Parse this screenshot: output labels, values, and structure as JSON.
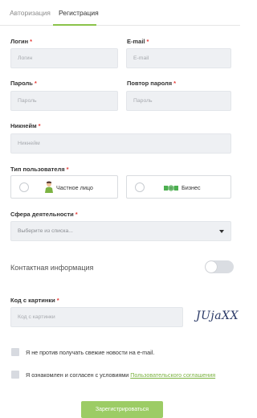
{
  "tabs": [
    {
      "label": "Авторизация",
      "active": false
    },
    {
      "label": "Регистрация",
      "active": true
    }
  ],
  "fields": {
    "login": {
      "label": "Логин",
      "placeholder": "Логин",
      "required": "*"
    },
    "email": {
      "label": "E-mail",
      "placeholder": "E-mail",
      "required": "*"
    },
    "password": {
      "label": "Пароль",
      "placeholder": "Пароль",
      "required": "*"
    },
    "password_repeat": {
      "label": "Повтор пароля",
      "placeholder": "Пароль",
      "required": "*"
    },
    "nickname": {
      "label": "Никнейм",
      "placeholder": "Никнейм",
      "required": "*"
    }
  },
  "user_type": {
    "label": "Тип пользователя",
    "required": "*",
    "options": [
      {
        "label": "Частное лицо",
        "icon": "person-icon",
        "selected": false
      },
      {
        "label": "Бизнес",
        "icon": "handshake-icon",
        "selected": false
      }
    ]
  },
  "activity": {
    "label": "Сфера деятельности",
    "required": "*",
    "placeholder": "Выберите из списка..."
  },
  "contact_info": {
    "label": "Контактная информация",
    "enabled": false
  },
  "captcha": {
    "label": "Код с картинки",
    "required": "*",
    "placeholder": "Код с картинки",
    "image_text": "JUjaXX"
  },
  "checkboxes": {
    "news": {
      "label": "Я не против получать свежие новости на e-mail.",
      "checked": false
    },
    "terms": {
      "label_prefix": "Я ознакомлен и согласен с условиями ",
      "link": "Пользовательского соглашения",
      "checked": false
    }
  },
  "submit": {
    "label": "Зарегистрироваться"
  },
  "colors": {
    "accent": "#8bc34a",
    "link": "#7cb342",
    "required": "#e53935",
    "input_bg": "#eef0f3",
    "button": "#9ccc65"
  }
}
